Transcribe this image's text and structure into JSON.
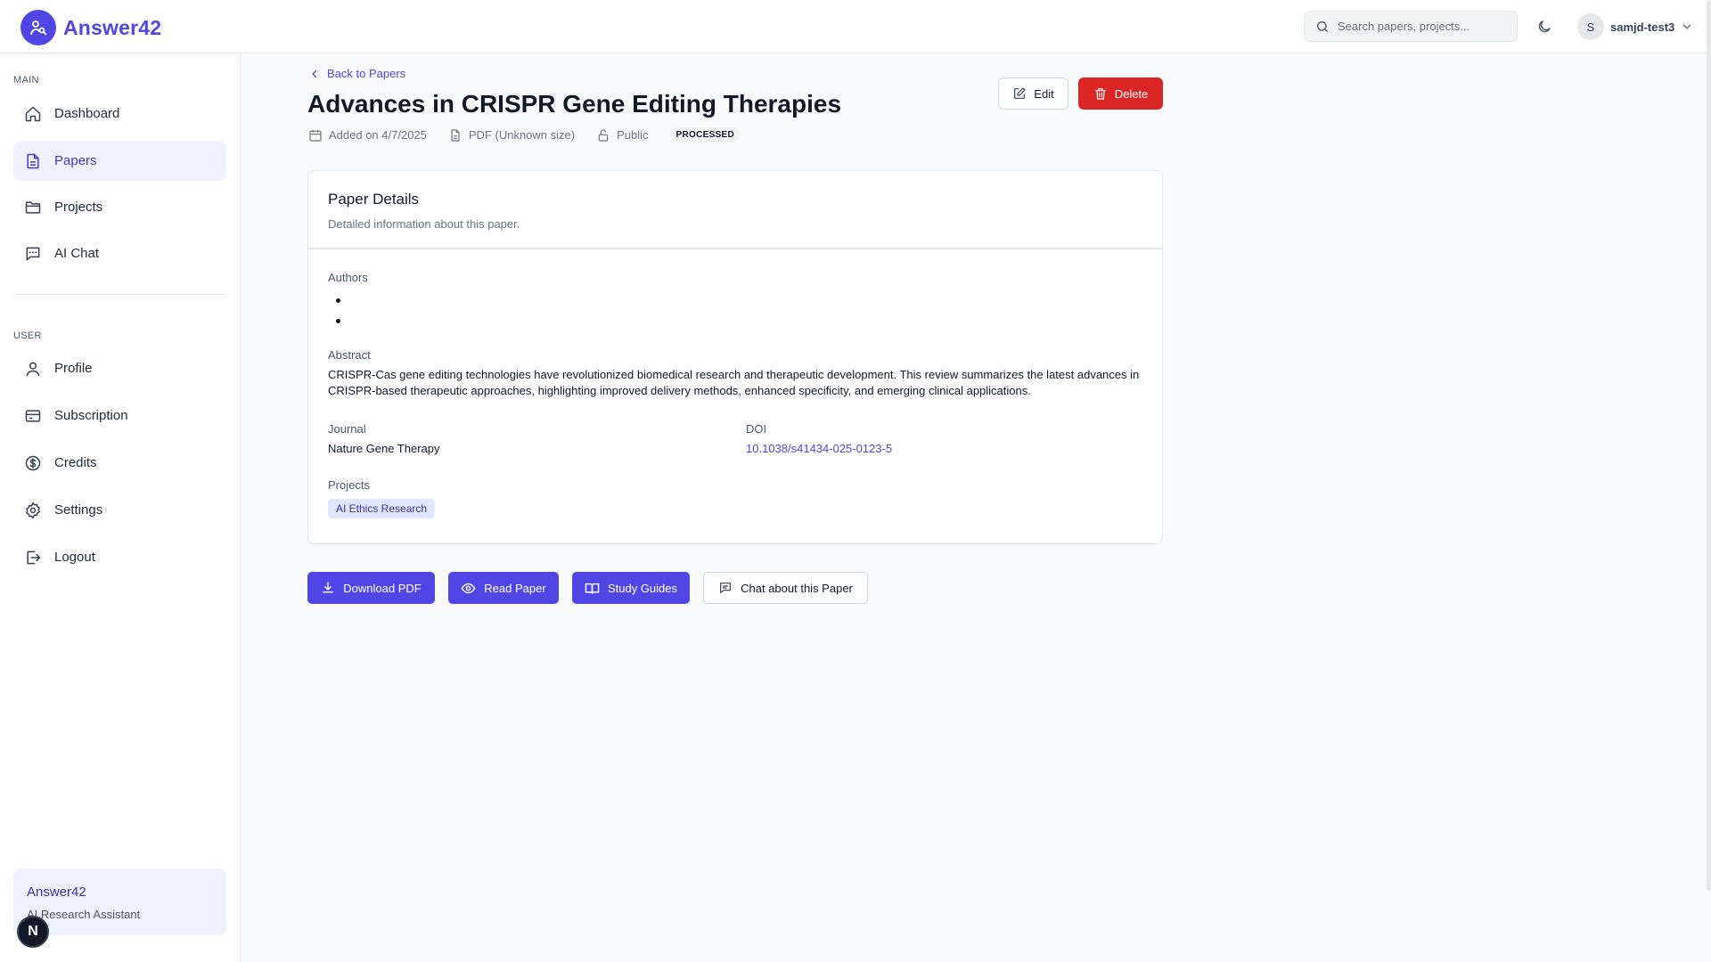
{
  "app": {
    "name": "Answer42"
  },
  "header": {
    "search_placeholder": "Search papers, projects...",
    "user_initial": "S",
    "username": "samjd-test3"
  },
  "sidebar": {
    "main_label": "MAIN",
    "main_items": [
      {
        "label": "Dashboard",
        "icon": "home-icon"
      },
      {
        "label": "Papers",
        "icon": "document-icon",
        "active": true
      },
      {
        "label": "Projects",
        "icon": "folder-icon"
      },
      {
        "label": "AI Chat",
        "icon": "chat-icon"
      }
    ],
    "user_label": "USER",
    "user_items": [
      {
        "label": "Profile",
        "icon": "user-icon"
      },
      {
        "label": "Subscription",
        "icon": "card-icon"
      },
      {
        "label": "Credits",
        "icon": "dollar-icon"
      },
      {
        "label": "Settings",
        "icon": "gear-icon"
      },
      {
        "label": "Logout",
        "icon": "logout-icon"
      }
    ],
    "promo": {
      "title": "Answer42",
      "subtitle": "AI Research Assistant"
    },
    "badge": "N"
  },
  "paper": {
    "back_label": "Back to Papers",
    "title": "Advances in CRISPR Gene Editing Therapies",
    "added": "Added on 4/7/2025",
    "file_info": "PDF (Unknown size)",
    "visibility": "Public",
    "status": "PROCESSED",
    "edit_label": "Edit",
    "delete_label": "Delete"
  },
  "details": {
    "title": "Paper Details",
    "subtitle": "Detailed information about this paper.",
    "authors_label": "Authors",
    "authors": [
      "",
      ""
    ],
    "abstract_label": "Abstract",
    "abstract": "CRISPR-Cas gene editing technologies have revolutionized biomedical research and therapeutic development. This review summarizes the latest advances in CRISPR-based therapeutic approaches, highlighting improved delivery methods, enhanced specificity, and emerging clinical applications.",
    "journal_label": "Journal",
    "journal": "Nature Gene Therapy",
    "doi_label": "DOI",
    "doi": "10.1038/s41434-025-0123-5",
    "projects_label": "Projects",
    "projects": [
      "AI Ethics Research"
    ]
  },
  "actions": {
    "download": "Download PDF",
    "read": "Read Paper",
    "study": "Study Guides",
    "chat": "Chat about this Paper"
  },
  "colors": {
    "brand": "#4f46e5",
    "danger": "#dc2626",
    "active_nav_bg": "#eef2ff"
  }
}
